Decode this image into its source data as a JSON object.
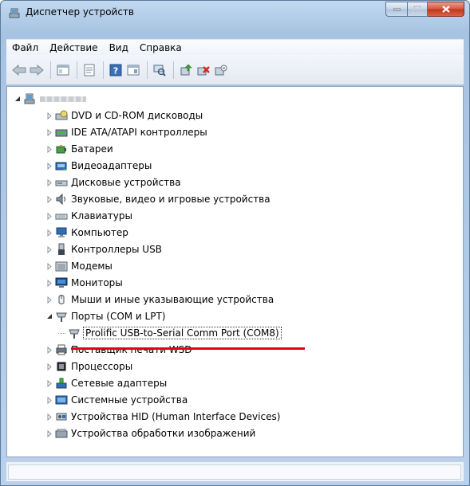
{
  "window": {
    "title": "Диспетчер устройств"
  },
  "menu": {
    "items": [
      "Файл",
      "Действие",
      "Вид",
      "Справка"
    ]
  },
  "toolbar": {
    "icons": [
      "back-arrow-icon",
      "forward-arrow-icon",
      "show-tree-icon",
      "properties-icon",
      "help-icon",
      "view-icon",
      "scan-hardware-icon",
      "update-driver-icon",
      "uninstall-icon",
      "disable-icon"
    ]
  },
  "tree": {
    "root": {
      "label": ""
    },
    "categories": [
      {
        "label": "DVD и CD-ROM дисководы",
        "icon": "dvd-icon"
      },
      {
        "label": "IDE ATA/ATAPI контроллеры",
        "icon": "ide-controller-icon"
      },
      {
        "label": "Батареи",
        "icon": "battery-icon"
      },
      {
        "label": "Видеоадаптеры",
        "icon": "display-adapter-icon"
      },
      {
        "label": "Дисковые устройства",
        "icon": "disk-drive-icon"
      },
      {
        "label": "Звуковые, видео и игровые устройства",
        "icon": "speaker-icon"
      },
      {
        "label": "Клавиатуры",
        "icon": "keyboard-icon"
      },
      {
        "label": "Компьютер",
        "icon": "computer-icon"
      },
      {
        "label": "Контроллеры USB",
        "icon": "usb-icon"
      },
      {
        "label": "Модемы",
        "icon": "modem-icon"
      },
      {
        "label": "Мониторы",
        "icon": "monitor-icon"
      },
      {
        "label": "Мыши и иные указывающие устройства",
        "icon": "mouse-icon"
      },
      {
        "label": "Порты (COM и LPT)",
        "icon": "port-icon"
      },
      {
        "label": "Prolific USB-to-Serial Comm Port (COM8)",
        "icon": "port-icon"
      },
      {
        "label": "Поставщик печати WSD",
        "icon": "printer-icon"
      },
      {
        "label": "Процессоры",
        "icon": "processor-icon"
      },
      {
        "label": "Сетевые адаптеры",
        "icon": "network-adapter-icon"
      },
      {
        "label": "Системные устройства",
        "icon": "system-device-icon"
      },
      {
        "label": "Устройства HID (Human Interface Devices)",
        "icon": "hid-icon"
      },
      {
        "label": "Устройства обработки изображений",
        "icon": "imaging-device-icon"
      }
    ]
  },
  "colors": {
    "highlight_underline": "#e0001b"
  }
}
